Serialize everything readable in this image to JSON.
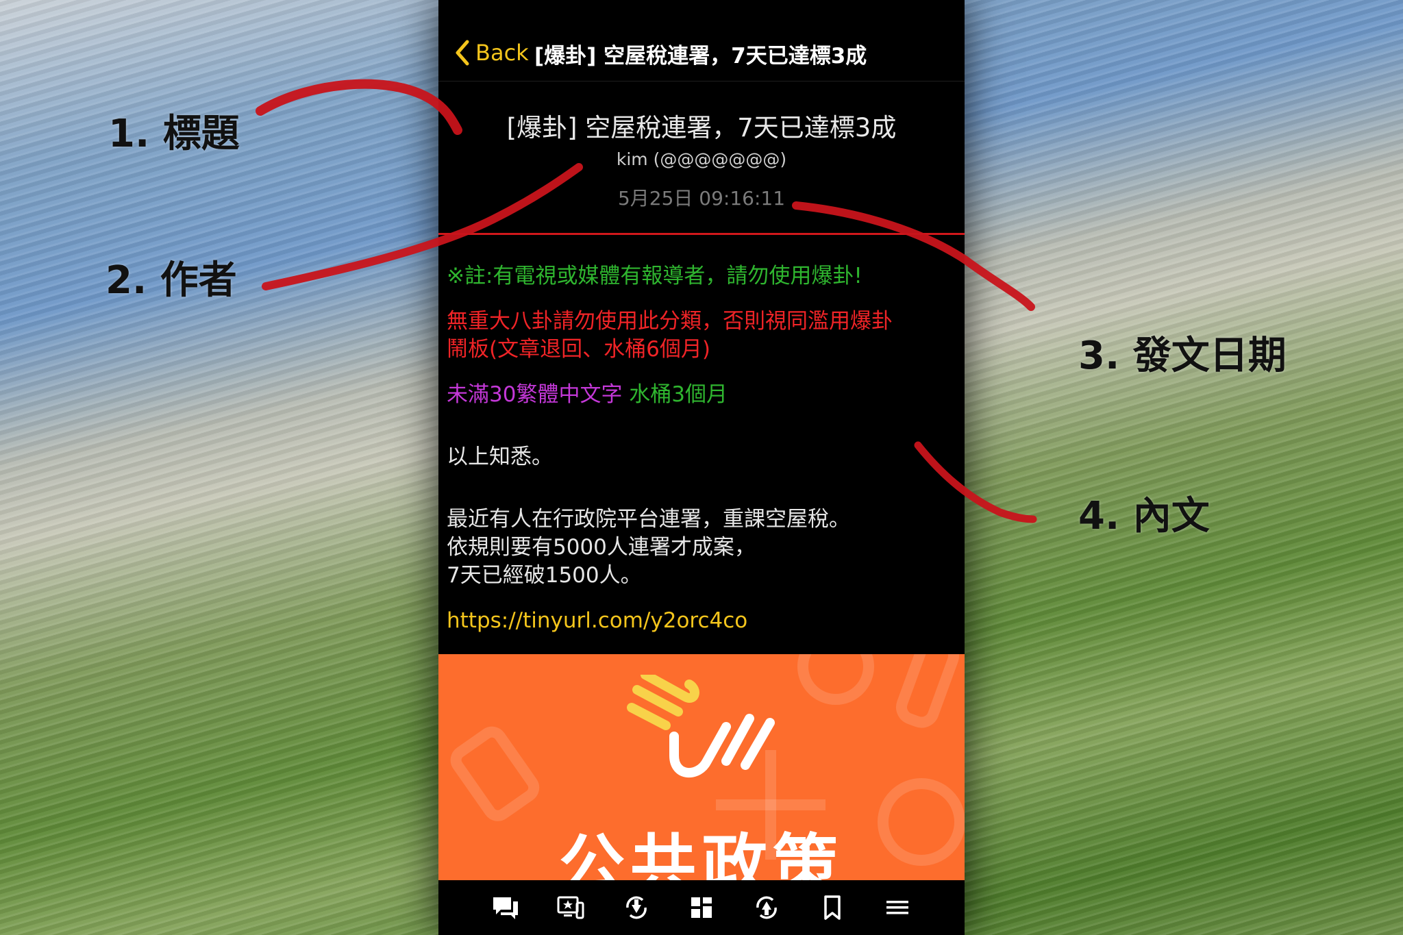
{
  "annotations": {
    "title_label": "1. 標題",
    "author_label": "2. 作者",
    "date_label": "3. 發文日期",
    "content_label": "4. 內文"
  },
  "navbar": {
    "back_label": "Back",
    "title": "[爆卦] 空屋稅連署，7天已達標3成"
  },
  "post": {
    "title": "[爆卦] 空屋稅連署，7天已達標3成",
    "author": "kim (@@@@@@@)",
    "date": "5月25日 09:16:11"
  },
  "content": {
    "note": "※註:有電視或媒體有報導者，請勿使用爆卦!",
    "warning_line1": "無重大八卦請勿使用此分類，否則視同濫用爆卦",
    "warning_line2": "鬧板(文章退回、水桶6個月)",
    "rule_part1": "未滿30繁體中文字",
    "rule_part2": " 水桶3個月",
    "ack": "以上知悉。",
    "para_line1": "最近有人在行政院平台連署，重課空屋稅。",
    "para_line2": "依規則要有5000人連署才成案，",
    "para_line3": "7天已經破1500人。",
    "link": "https://tinyurl.com/y2orc4co"
  },
  "banner": {
    "text": "公共政策"
  },
  "colors": {
    "accent_yellow": "#f4c51c",
    "divider_red": "#d0181b",
    "note_green": "#2fb52f",
    "warning_red": "#f02427",
    "rule_magenta": "#c438d8",
    "banner_orange": "#fd6d2d"
  },
  "tabbar": {
    "icons": [
      "comments-icon",
      "screen-star-icon",
      "refresh-down-icon",
      "grid-icon",
      "refresh-up-icon",
      "bookmark-icon",
      "menu-icon"
    ]
  }
}
